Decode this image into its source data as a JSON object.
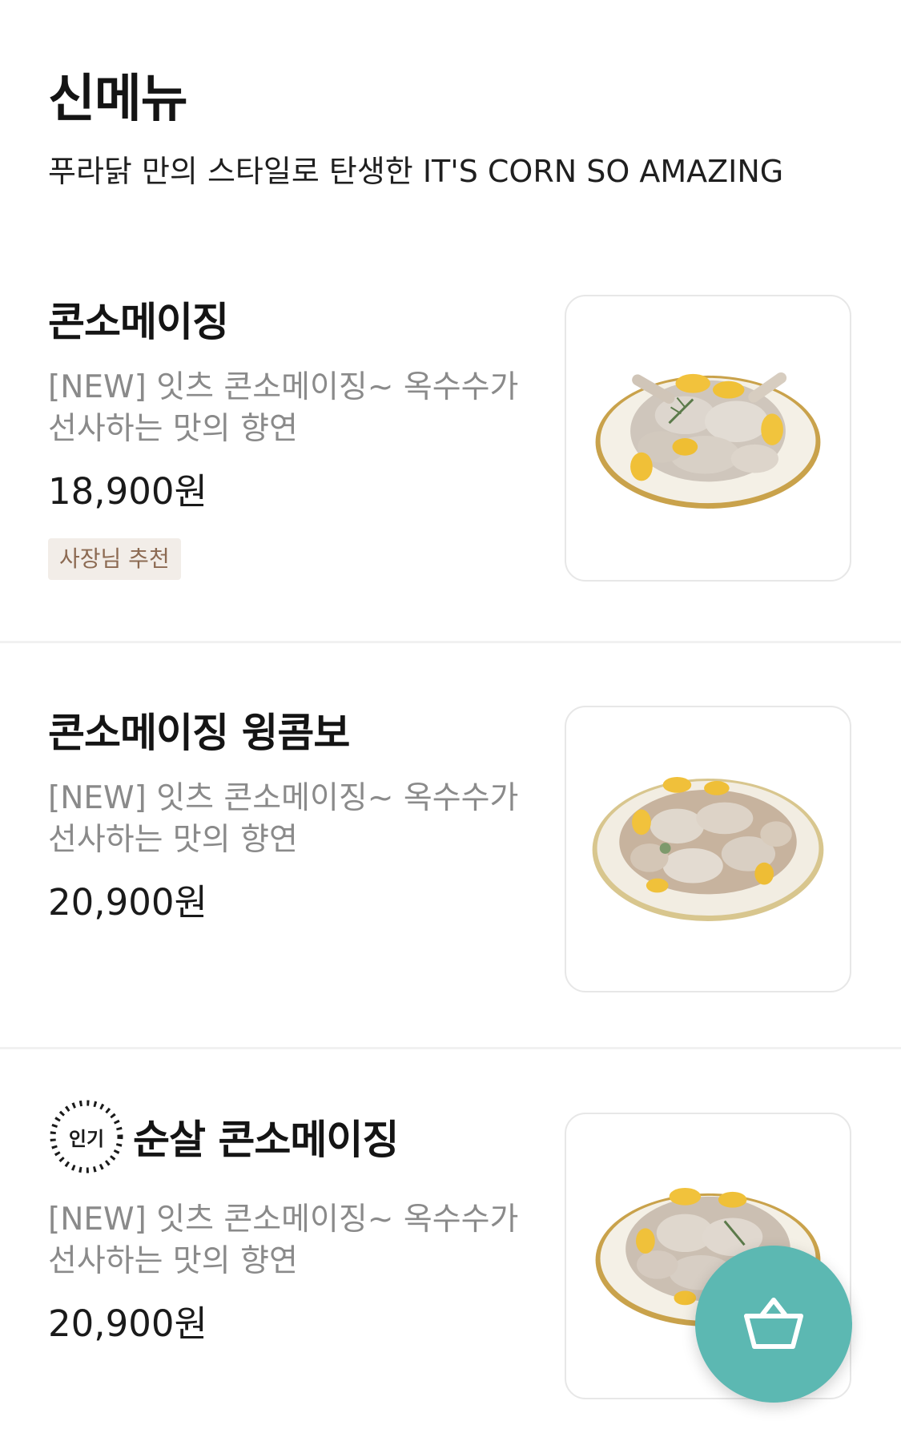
{
  "header": {
    "title": "신메뉴",
    "subtitle": "푸라닭 만의 스타일로 탄생한 IT'S CORN SO AMAZING"
  },
  "menu": [
    {
      "name": "콘소메이징",
      "description": "[NEW] 잇츠 콘소메이징~ 옥수수가 선사하는 맛의 향연",
      "price": "18,900원",
      "badge": "사장님 추천",
      "image_icon": "chicken-plate-image"
    },
    {
      "name": "콘소메이징 윙콤보",
      "description": "[NEW] 잇츠 콘소메이징~ 옥수수가 선사하는 맛의 향연",
      "price": "20,900원",
      "image_icon": "wing-combo-plate-image"
    },
    {
      "name": "순살 콘소메이징",
      "description": "[NEW] 잇츠 콘소메이징~ 옥수수가 선사하는 맛의 향연",
      "price": "20,900원",
      "popular_label": "인기",
      "image_icon": "boneless-plate-image"
    }
  ],
  "cart_button": {
    "icon": "basket-icon"
  },
  "colors": {
    "accent": "#5cb8b2",
    "badge_bg": "#f2ede8",
    "badge_text": "#8c6a52",
    "description_text": "#8a8a8a"
  }
}
